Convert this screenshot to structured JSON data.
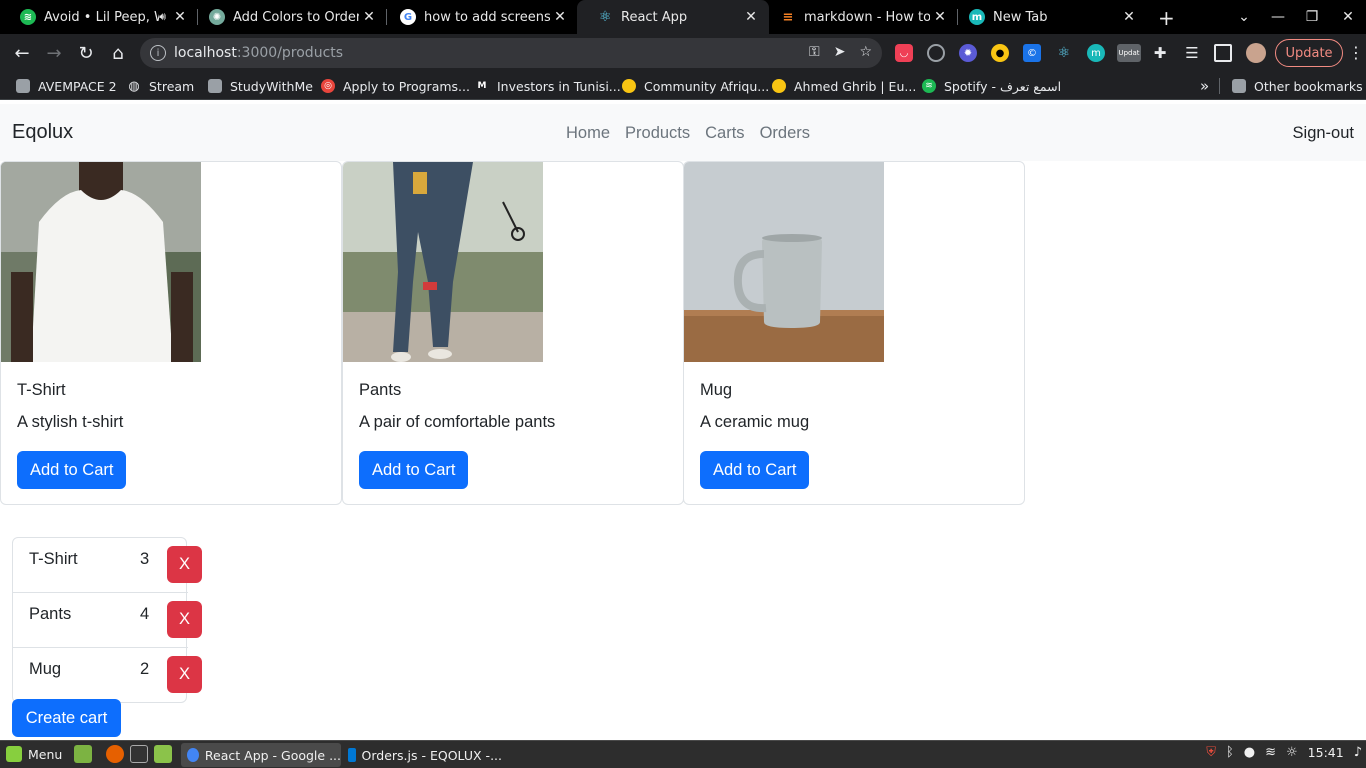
{
  "browser": {
    "tabs": [
      {
        "title": "Avoid • Lil Peep, W",
        "icon": "spotify-icon",
        "color": "#1db954"
      },
      {
        "title": "Add Colors to Orders",
        "icon": "chatgpt-icon",
        "color": "#74aa9c"
      },
      {
        "title": "how to add screenshot",
        "icon": "google-icon",
        "color": "#4285f4"
      },
      {
        "title": "React App",
        "icon": "react-icon",
        "color": "#61dafb"
      },
      {
        "title": "markdown - How to ad",
        "icon": "stackoverflow-icon",
        "color": "#f48024"
      },
      {
        "title": "New Tab",
        "icon": "new-tab-icon",
        "color": "#19b8b8"
      }
    ],
    "url_host": "localhost",
    "url_path": ":3000/products",
    "update_label": "Update",
    "bookmarks": [
      {
        "label": "AVEMPACE 2",
        "icon": "folder-icon"
      },
      {
        "label": "Stream",
        "icon": "globe-icon"
      },
      {
        "label": "StudyWithMe",
        "icon": "folder-icon"
      },
      {
        "label": "Apply to Programs...",
        "icon": "programs-icon"
      },
      {
        "label": "Investors in Tunisi...",
        "icon": "m-logo-icon"
      },
      {
        "label": "Community Afriqu...",
        "icon": "community-icon"
      },
      {
        "label": "Ahmed Ghrib | Eu...",
        "icon": "community-icon"
      },
      {
        "label": "Spotify - اسمع تعرف",
        "icon": "spotify-icon"
      }
    ],
    "other_bookmarks": "Other bookmarks",
    "overflow": "»"
  },
  "app": {
    "brand": "Eqolux",
    "nav": [
      "Home",
      "Products",
      "Carts",
      "Orders"
    ],
    "signout": "Sign-out",
    "products": [
      {
        "name": "T-Shirt",
        "description": "A stylish t-shirt",
        "button": "Add to Cart"
      },
      {
        "name": "Pants",
        "description": "A pair of comfortable pants",
        "button": "Add to Cart"
      },
      {
        "name": "Mug",
        "description": "A ceramic mug",
        "button": "Add to Cart"
      }
    ],
    "cart": [
      {
        "name": "T-Shirt",
        "qty": "3",
        "remove": "X"
      },
      {
        "name": "Pants",
        "qty": "4",
        "remove": "X"
      },
      {
        "name": "Mug",
        "qty": "2",
        "remove": "X"
      }
    ],
    "create_cart": "Create cart",
    "colors": {
      "primary": "#0d6efd",
      "danger": "#dc3545",
      "navbar": "#f8f9fa"
    }
  },
  "taskbar": {
    "menu": "Menu",
    "windows": [
      "React App - Google ...",
      "Orders.js - EQOLUX -..."
    ],
    "time": "15:41"
  }
}
